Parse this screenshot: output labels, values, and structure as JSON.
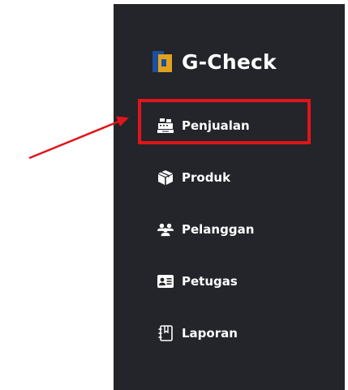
{
  "brand": {
    "name": "G-Check",
    "logo_icon": "g-check-logo"
  },
  "nav": {
    "items": [
      {
        "label": "Penjualan",
        "icon": "cash-register-icon"
      },
      {
        "label": "Produk",
        "icon": "box-icon"
      },
      {
        "label": "Pelanggan",
        "icon": "users-icon"
      },
      {
        "label": "Petugas",
        "icon": "id-card-icon"
      },
      {
        "label": "Laporan",
        "icon": "notebook-icon"
      }
    ]
  },
  "annotation": {
    "highlight_color": "#e1141b",
    "highlighted_item": "Penjualan"
  },
  "colors": {
    "sidebar_bg": "#23252a",
    "text": "#ffffff"
  }
}
